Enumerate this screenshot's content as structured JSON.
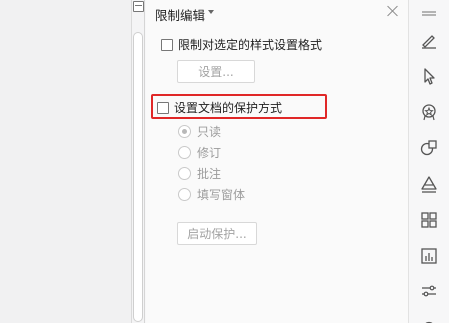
{
  "panel": {
    "title": "限制编辑",
    "format_restrict": {
      "label": "限制对选定的样式设置格式",
      "checked": false,
      "settings_button": "设置..."
    },
    "protection": {
      "label": "设置文档的保护方式",
      "checked": false,
      "options": [
        {
          "label": "只读",
          "selected": true
        },
        {
          "label": "修订",
          "selected": false
        },
        {
          "label": "批注",
          "selected": false
        },
        {
          "label": "填写窗体",
          "selected": false
        }
      ],
      "start_button": "启动保护..."
    }
  },
  "toolbar": {
    "icons": [
      "pen-icon",
      "cursor-icon",
      "award-icon",
      "shapes-icon",
      "layers-icon",
      "grid-icon",
      "bar-chart-icon",
      "settings-sliders-icon"
    ]
  },
  "colors": {
    "highlight": "#e02727",
    "disabled_text": "#a3a3a3"
  }
}
